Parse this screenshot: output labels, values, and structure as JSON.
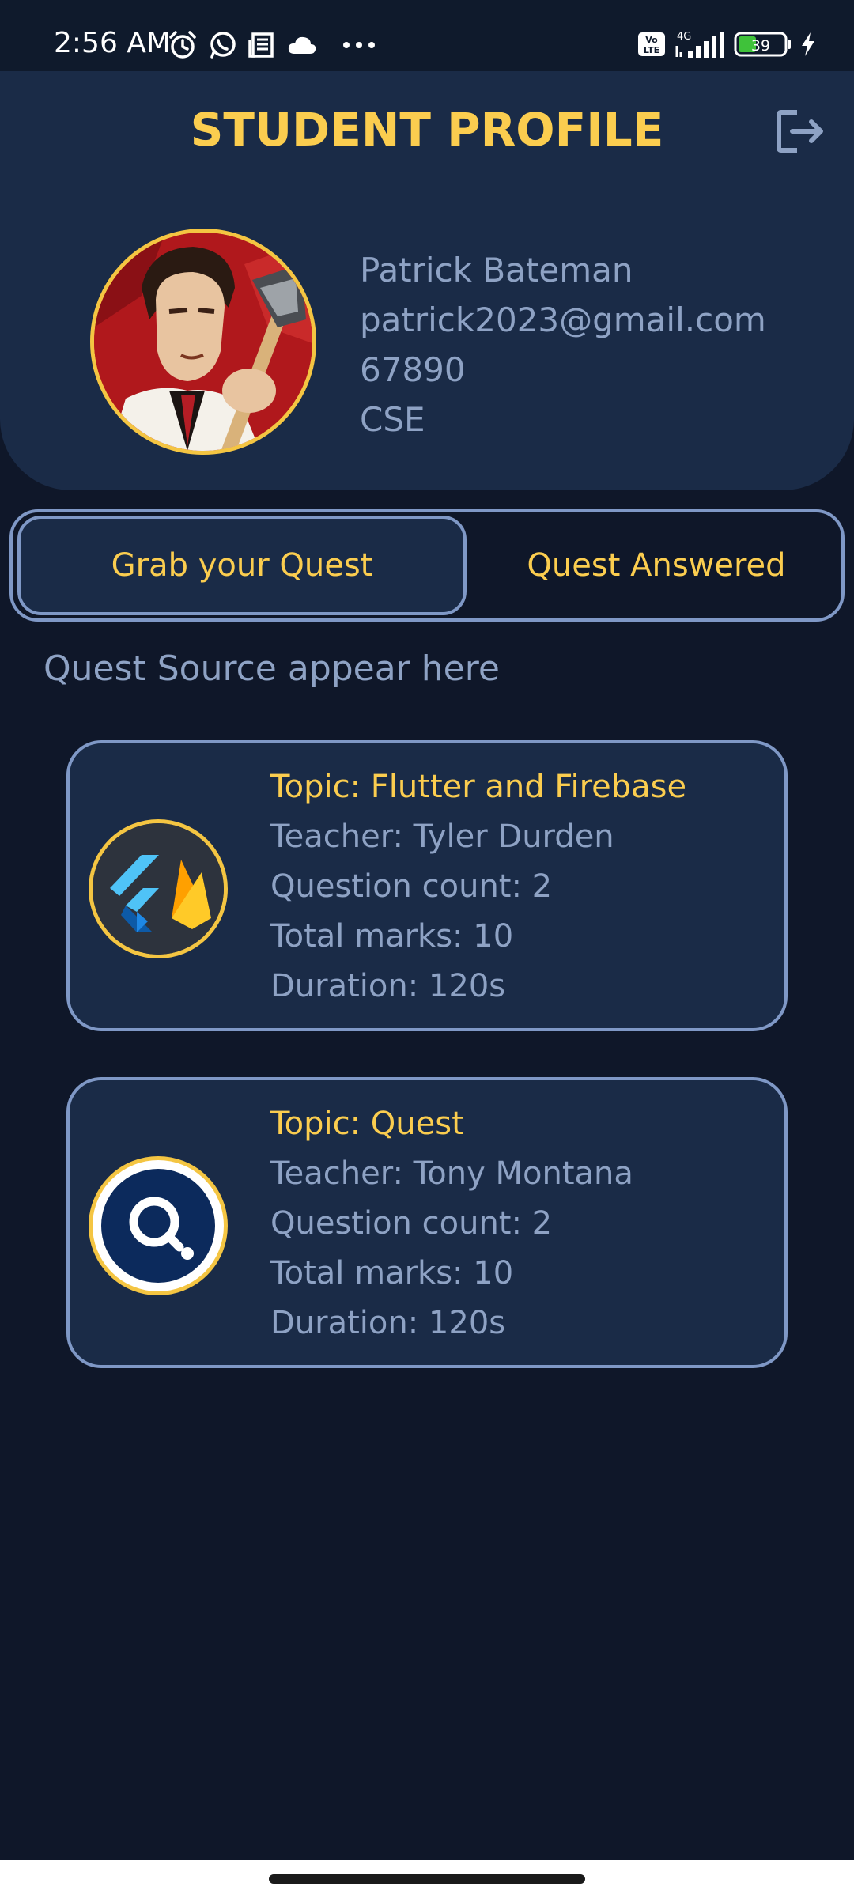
{
  "status_bar": {
    "time": "2:56 AM",
    "network": "4G",
    "volte": "Vo LTE",
    "battery": "39",
    "left_icons": [
      "alarm-icon",
      "whatsapp-icon",
      "news-icon",
      "cloud-icon",
      "more-dots-icon"
    ],
    "right_icons": [
      "volte-icon",
      "signal-icon",
      "battery-icon",
      "charging-icon"
    ]
  },
  "header": {
    "title": "STUDENT PROFILE",
    "logout_icon": "logout-icon"
  },
  "profile": {
    "name": "Patrick Bateman",
    "email": "patrick2023@gmail.com",
    "id": "67890",
    "department": "CSE"
  },
  "tabs": [
    {
      "label": "Grab your Quest",
      "active": true
    },
    {
      "label": "Quest Answered",
      "active": false
    }
  ],
  "section_label": "Quest Source appear here",
  "quests": [
    {
      "topic": "Topic: Flutter and Firebase",
      "teacher": "Teacher: Tyler Durden",
      "question_count": "Question count: 2",
      "total_marks": "Total marks: 10",
      "duration": "Duration: 120s",
      "logo": "flutter-firebase-logo"
    },
    {
      "topic": "Topic: Quest",
      "teacher": "Teacher: Tony Montana",
      "question_count": "Question count: 2",
      "total_marks": "Total marks: 10",
      "duration": "Duration: 120s",
      "logo": "quest-logo"
    }
  ],
  "colors": {
    "background": "#0f1729",
    "panel": "#1a2b47",
    "accent": "#fbcd4f",
    "text": "#8ea2c4",
    "border": "#7f98c6"
  }
}
